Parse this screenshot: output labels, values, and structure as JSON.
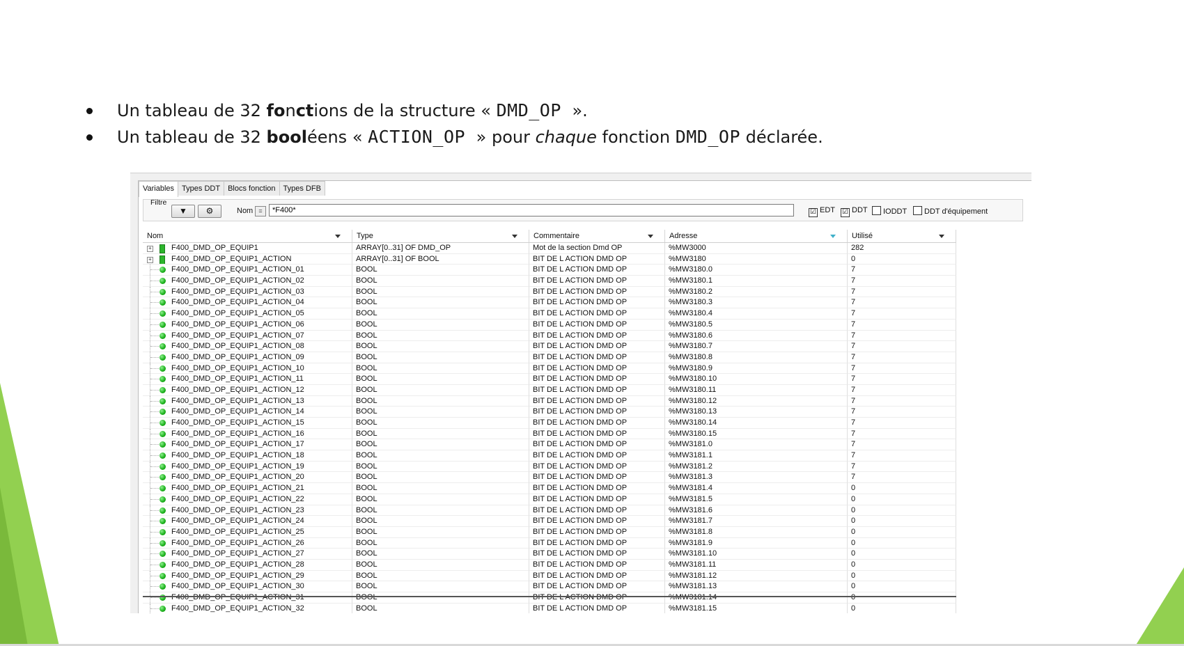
{
  "bullets": {
    "line1": {
      "pre": "Un tableau de 32 ",
      "b1": "fo",
      "mid1": "n",
      "b2": "ct",
      "post": "ions de la structure « ",
      "code": "DMD_OP ",
      "end": "»."
    },
    "line2": {
      "pre": "Un tableau de 32 ",
      "b1": "bool",
      "mid1": "éens « ",
      "code": "ACTION_OP ",
      "mid2": "» pour ",
      "italic": "chaque",
      "mid3": " fonction ",
      "code2": "DMD_OP",
      "end": " déclarée."
    }
  },
  "tabs": [
    "Variables",
    "Types DDT",
    "Blocs fonction",
    "Types DFB"
  ],
  "filter": {
    "label": "Filtre",
    "funnel_icon": "▼",
    "gears_icon": "⚙",
    "nom_label": "Nom",
    "eq_label": "=",
    "value": "*F400*",
    "checks": [
      {
        "label": "EDT",
        "checked": "☑"
      },
      {
        "label": "DDT",
        "checked": "☑"
      },
      {
        "label": "IODDT",
        "checked": ""
      },
      {
        "label": "DDT d'équipement",
        "checked": ""
      }
    ]
  },
  "columns": [
    "Nom",
    "Type",
    "Commentaire",
    "Adresse",
    "Utilisé"
  ],
  "rows": [
    {
      "name": "F400_DMD_OP_EQUIP1",
      "type": "ARRAY[0..31] OF DMD_OP",
      "comment": "Mot de la section Dmd OP",
      "address": "%MW3000",
      "used": "282",
      "icon": "structure-icon"
    },
    {
      "name": "F400_DMD_OP_EQUIP1_ACTION",
      "type": "ARRAY[0..31] OF BOOL",
      "comment": "BIT DE L ACTION DMD OP",
      "address": "%MW3180",
      "used": "0",
      "icon": "structure-icon"
    },
    {
      "name": "F400_DMD_OP_EQUIP1_ACTION_01",
      "type": "BOOL",
      "comment": "BIT DE L ACTION DMD OP",
      "address": "%MW3180.0",
      "used": "7",
      "icon": "bool-icon"
    },
    {
      "name": "F400_DMD_OP_EQUIP1_ACTION_02",
      "type": "BOOL",
      "comment": "BIT DE L ACTION DMD OP",
      "address": "%MW3180.1",
      "used": "7",
      "icon": "bool-icon"
    },
    {
      "name": "F400_DMD_OP_EQUIP1_ACTION_03",
      "type": "BOOL",
      "comment": "BIT DE L ACTION DMD OP",
      "address": "%MW3180.2",
      "used": "7",
      "icon": "bool-icon"
    },
    {
      "name": "F400_DMD_OP_EQUIP1_ACTION_04",
      "type": "BOOL",
      "comment": "BIT DE L ACTION DMD OP",
      "address": "%MW3180.3",
      "used": "7",
      "icon": "bool-icon"
    },
    {
      "name": "F400_DMD_OP_EQUIP1_ACTION_05",
      "type": "BOOL",
      "comment": "BIT DE L ACTION DMD OP",
      "address": "%MW3180.4",
      "used": "7",
      "icon": "bool-icon"
    },
    {
      "name": "F400_DMD_OP_EQUIP1_ACTION_06",
      "type": "BOOL",
      "comment": "BIT DE L ACTION DMD OP",
      "address": "%MW3180.5",
      "used": "7",
      "icon": "bool-icon"
    },
    {
      "name": "F400_DMD_OP_EQUIP1_ACTION_07",
      "type": "BOOL",
      "comment": "BIT DE L ACTION DMD OP",
      "address": "%MW3180.6",
      "used": "7",
      "icon": "bool-icon"
    },
    {
      "name": "F400_DMD_OP_EQUIP1_ACTION_08",
      "type": "BOOL",
      "comment": "BIT DE L ACTION DMD OP",
      "address": "%MW3180.7",
      "used": "7",
      "icon": "bool-icon"
    },
    {
      "name": "F400_DMD_OP_EQUIP1_ACTION_09",
      "type": "BOOL",
      "comment": "BIT DE L ACTION DMD OP",
      "address": "%MW3180.8",
      "used": "7",
      "icon": "bool-icon"
    },
    {
      "name": "F400_DMD_OP_EQUIP1_ACTION_10",
      "type": "BOOL",
      "comment": "BIT DE L ACTION DMD OP",
      "address": "%MW3180.9",
      "used": "7",
      "icon": "bool-icon"
    },
    {
      "name": "F400_DMD_OP_EQUIP1_ACTION_11",
      "type": "BOOL",
      "comment": "BIT DE L ACTION DMD OP",
      "address": "%MW3180.10",
      "used": "7",
      "icon": "bool-icon"
    },
    {
      "name": "F400_DMD_OP_EQUIP1_ACTION_12",
      "type": "BOOL",
      "comment": "BIT DE L ACTION DMD OP",
      "address": "%MW3180.11",
      "used": "7",
      "icon": "bool-icon"
    },
    {
      "name": "F400_DMD_OP_EQUIP1_ACTION_13",
      "type": "BOOL",
      "comment": "BIT DE L ACTION DMD OP",
      "address": "%MW3180.12",
      "used": "7",
      "icon": "bool-icon"
    },
    {
      "name": "F400_DMD_OP_EQUIP1_ACTION_14",
      "type": "BOOL",
      "comment": "BIT DE L ACTION DMD OP",
      "address": "%MW3180.13",
      "used": "7",
      "icon": "bool-icon"
    },
    {
      "name": "F400_DMD_OP_EQUIP1_ACTION_15",
      "type": "BOOL",
      "comment": "BIT DE L ACTION DMD OP",
      "address": "%MW3180.14",
      "used": "7",
      "icon": "bool-icon"
    },
    {
      "name": "F400_DMD_OP_EQUIP1_ACTION_16",
      "type": "BOOL",
      "comment": "BIT DE L ACTION DMD OP",
      "address": "%MW3180.15",
      "used": "7",
      "icon": "bool-icon"
    },
    {
      "name": "F400_DMD_OP_EQUIP1_ACTION_17",
      "type": "BOOL",
      "comment": "BIT DE L ACTION DMD OP",
      "address": "%MW3181.0",
      "used": "7",
      "icon": "bool-icon"
    },
    {
      "name": "F400_DMD_OP_EQUIP1_ACTION_18",
      "type": "BOOL",
      "comment": "BIT DE L ACTION DMD OP",
      "address": "%MW3181.1",
      "used": "7",
      "icon": "bool-icon"
    },
    {
      "name": "F400_DMD_OP_EQUIP1_ACTION_19",
      "type": "BOOL",
      "comment": "BIT DE L ACTION DMD OP",
      "address": "%MW3181.2",
      "used": "7",
      "icon": "bool-icon"
    },
    {
      "name": "F400_DMD_OP_EQUIP1_ACTION_20",
      "type": "BOOL",
      "comment": "BIT DE L ACTION DMD OP",
      "address": "%MW3181.3",
      "used": "7",
      "icon": "bool-icon"
    },
    {
      "name": "F400_DMD_OP_EQUIP1_ACTION_21",
      "type": "BOOL",
      "comment": "BIT DE L ACTION DMD OP",
      "address": "%MW3181.4",
      "used": "0",
      "icon": "bool-icon"
    },
    {
      "name": "F400_DMD_OP_EQUIP1_ACTION_22",
      "type": "BOOL",
      "comment": "BIT DE L ACTION DMD OP",
      "address": "%MW3181.5",
      "used": "0",
      "icon": "bool-icon"
    },
    {
      "name": "F400_DMD_OP_EQUIP1_ACTION_23",
      "type": "BOOL",
      "comment": "BIT DE L ACTION DMD OP",
      "address": "%MW3181.6",
      "used": "0",
      "icon": "bool-icon"
    },
    {
      "name": "F400_DMD_OP_EQUIP1_ACTION_24",
      "type": "BOOL",
      "comment": "BIT DE L ACTION DMD OP",
      "address": "%MW3181.7",
      "used": "0",
      "icon": "bool-icon"
    },
    {
      "name": "F400_DMD_OP_EQUIP1_ACTION_25",
      "type": "BOOL",
      "comment": "BIT DE L ACTION DMD OP",
      "address": "%MW3181.8",
      "used": "0",
      "icon": "bool-icon"
    },
    {
      "name": "F400_DMD_OP_EQUIP1_ACTION_26",
      "type": "BOOL",
      "comment": "BIT DE L ACTION DMD OP",
      "address": "%MW3181.9",
      "used": "0",
      "icon": "bool-icon"
    },
    {
      "name": "F400_DMD_OP_EQUIP1_ACTION_27",
      "type": "BOOL",
      "comment": "BIT DE L ACTION DMD OP",
      "address": "%MW3181.10",
      "used": "0",
      "icon": "bool-icon"
    },
    {
      "name": "F400_DMD_OP_EQUIP1_ACTION_28",
      "type": "BOOL",
      "comment": "BIT DE L ACTION DMD OP",
      "address": "%MW3181.11",
      "used": "0",
      "icon": "bool-icon"
    },
    {
      "name": "F400_DMD_OP_EQUIP1_ACTION_29",
      "type": "BOOL",
      "comment": "BIT DE L ACTION DMD OP",
      "address": "%MW3181.12",
      "used": "0",
      "icon": "bool-icon"
    },
    {
      "name": "F400_DMD_OP_EQUIP1_ACTION_30",
      "type": "BOOL",
      "comment": "BIT DE L ACTION DMD OP",
      "address": "%MW3181.13",
      "used": "0",
      "icon": "bool-icon"
    },
    {
      "name": "F400_DMD_OP_EQUIP1_ACTION_31",
      "type": "BOOL",
      "comment": "BIT DE L ACTION DMD OP",
      "address": "%MW3181.14",
      "used": "0",
      "icon": "bool-icon"
    },
    {
      "name": "F400_DMD_OP_EQUIP1_ACTION_32",
      "type": "BOOL",
      "comment": "BIT DE L ACTION DMD OP",
      "address": "%MW3181.15",
      "used": "0",
      "icon": "bool-icon"
    }
  ],
  "colors": {
    "accent_green": "#92d050",
    "bool_green": "#19b019"
  }
}
